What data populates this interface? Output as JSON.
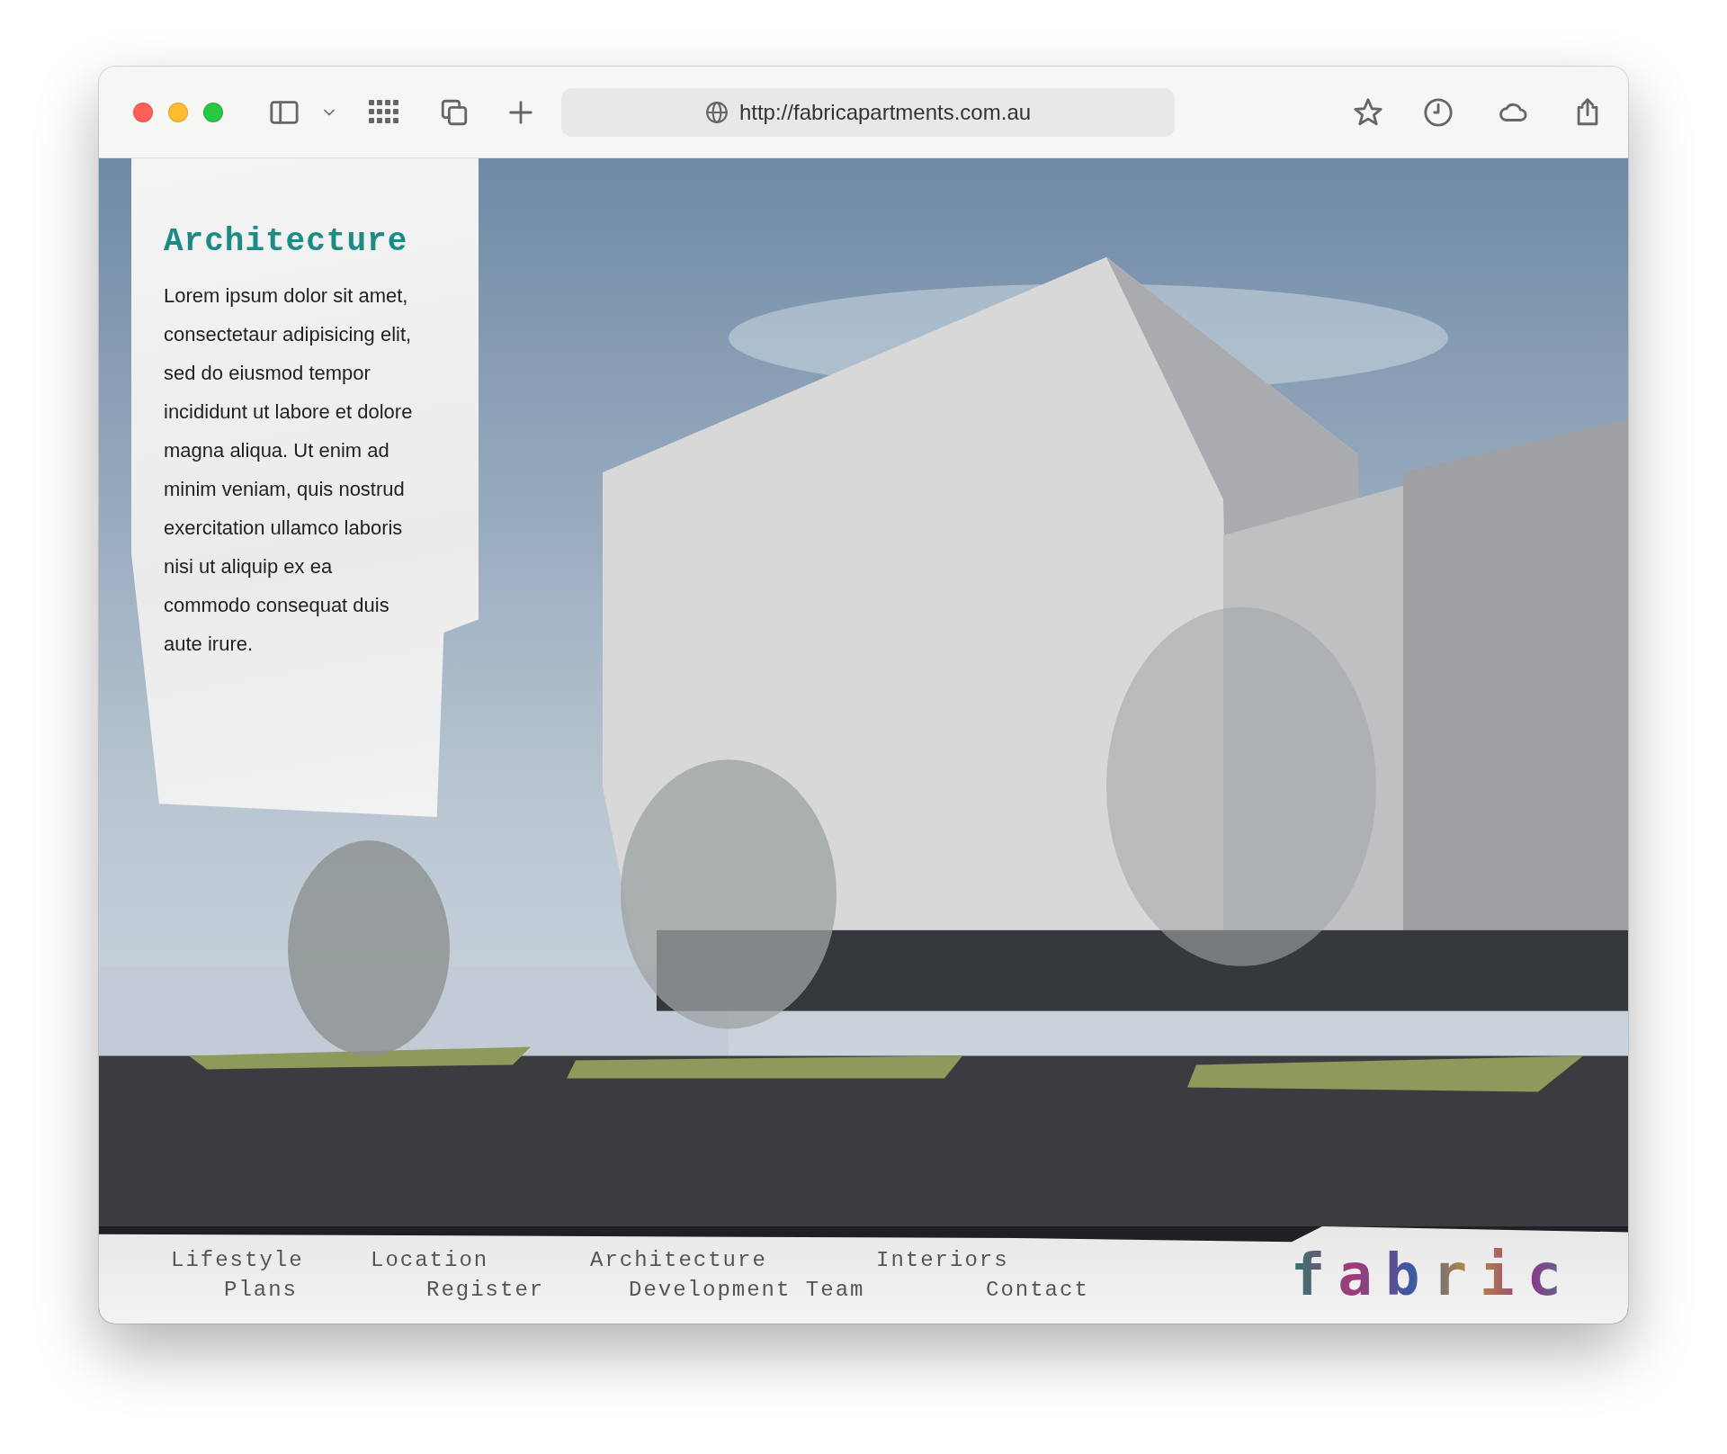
{
  "browser": {
    "url": "http://fabricapartments.com.au"
  },
  "card": {
    "title": "Architecture",
    "body": "Lorem ipsum dolor sit amet, consectetaur adipisicing elit, sed do eiusmod tempor incididunt ut labore et dolore magna aliqua. Ut enim ad minim veniam, quis nostrud exercitation ullamco laboris nisi ut aliquip ex ea commodo consequat duis aute irure."
  },
  "nav": {
    "rows": [
      [
        {
          "label": "Lifestyle"
        },
        {
          "label": "Location"
        },
        {
          "label": "Architecture"
        },
        {
          "label": "Interiors"
        }
      ],
      [
        {
          "label": "Plans"
        },
        {
          "label": "Register"
        },
        {
          "label": "Development Team"
        },
        {
          "label": "Contact"
        }
      ]
    ]
  },
  "logo": {
    "text": "fabric"
  }
}
